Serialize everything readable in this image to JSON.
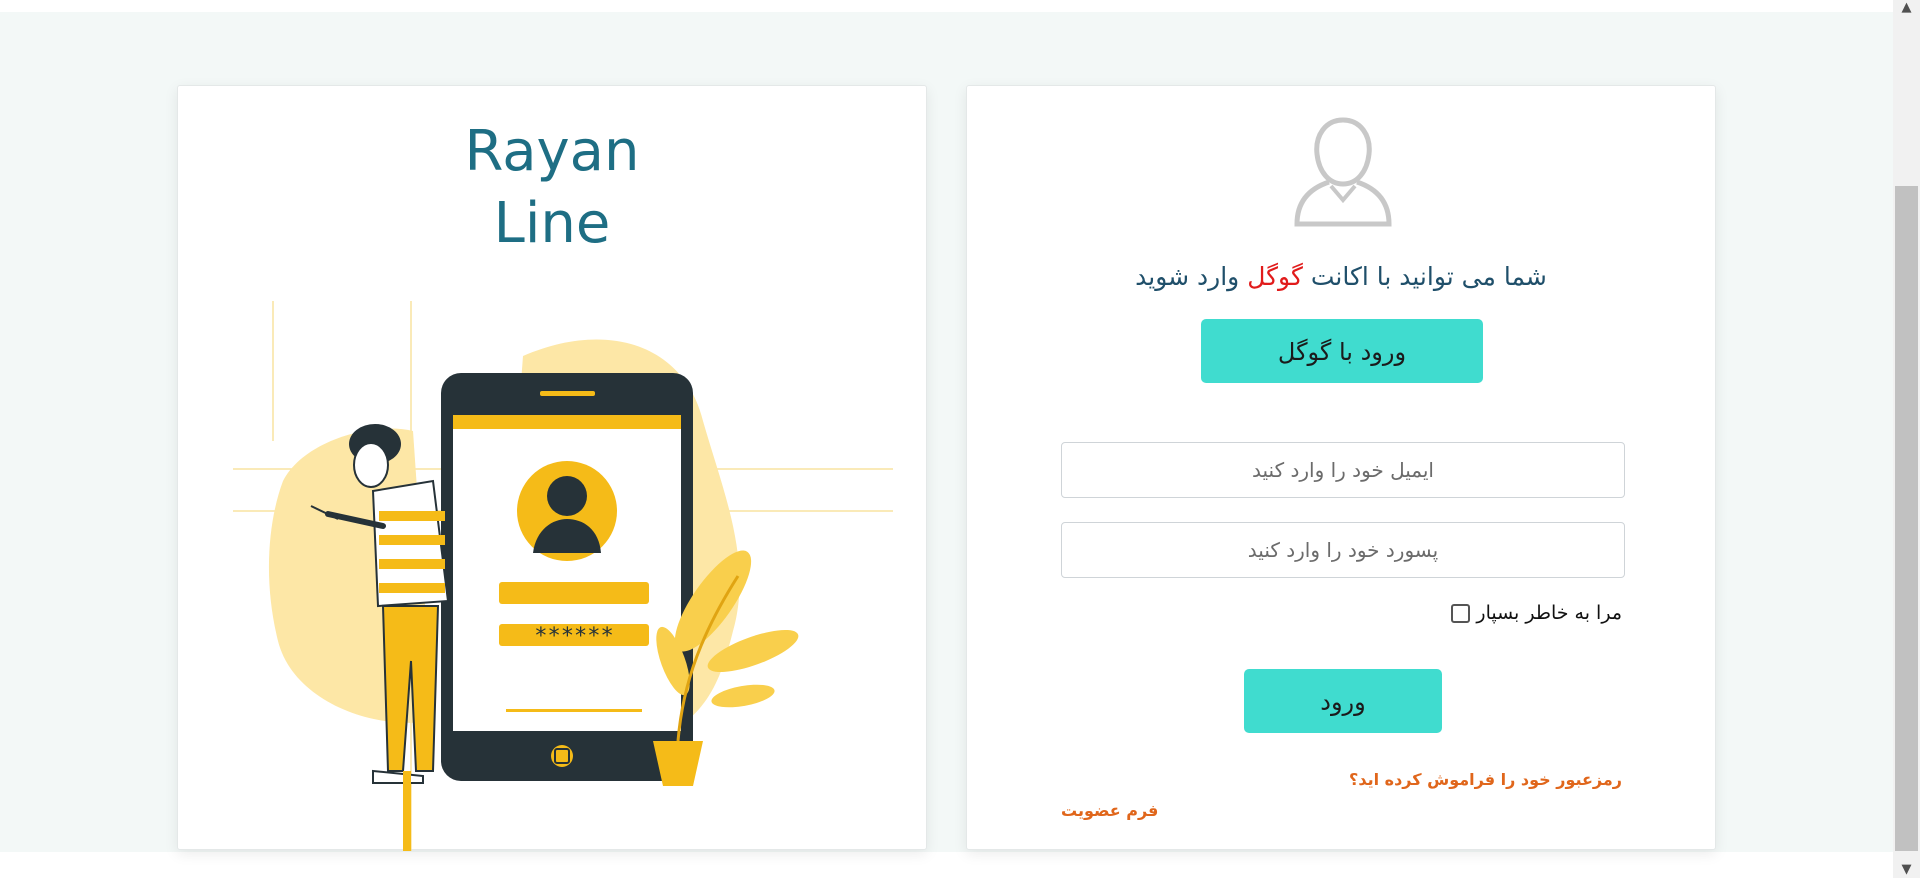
{
  "brand": {
    "line1": "Rayan",
    "line2": "Line"
  },
  "illustration": {
    "password_mask": "******"
  },
  "login": {
    "heading_part1": "شما می توانید با اکانت",
    "heading_highlight": "گوگل",
    "heading_part2": "وارد شوید",
    "google_button": "ورود با گوگل",
    "email_placeholder": "ایمیل خود را وارد کنید",
    "password_placeholder": "پسورد خود را وارد کنید",
    "remember_me": "مرا به خاطر بسپار",
    "submit_button": "ورود",
    "forgot_password": "رمزعبور خود را فراموش کرده اید؟",
    "register_link": "فرم عضویت"
  },
  "colors": {
    "brand": "#1e6e84",
    "accent_teal": "#40dccf",
    "highlight_red": "#e11b1b",
    "link_orange": "#e0661b",
    "illustration_yellow": "#f5bb18",
    "illustration_dark": "#263238"
  },
  "icons": {
    "user": "user-outline-icon",
    "scroll_up": "chevron-up-icon",
    "scroll_down": "chevron-down-icon"
  }
}
